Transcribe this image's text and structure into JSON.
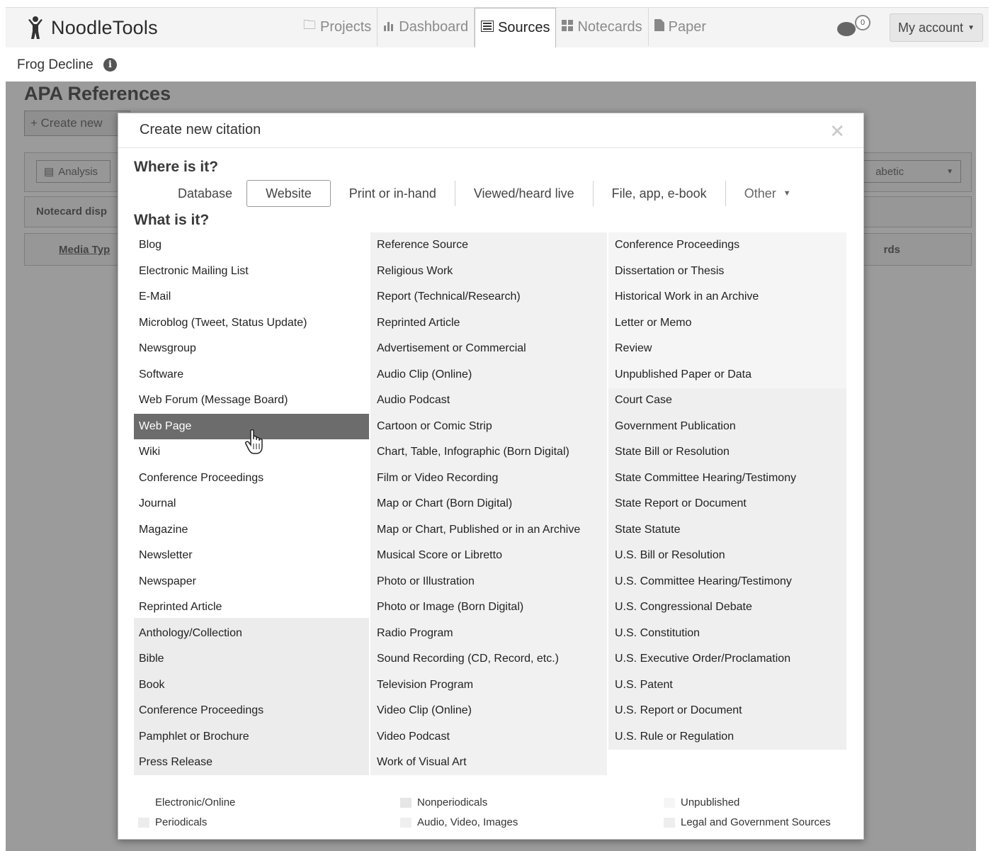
{
  "app": {
    "brand": "NoodleTools",
    "nav": [
      {
        "label": "Projects",
        "icon": "folder-icon"
      },
      {
        "label": "Dashboard",
        "icon": "bar-chart-icon"
      },
      {
        "label": "Sources",
        "icon": "list-icon",
        "active": true
      },
      {
        "label": "Notecards",
        "icon": "grid-icon"
      },
      {
        "label": "Paper",
        "icon": "document-icon"
      }
    ],
    "notifications_count": "0",
    "account_label": "My account"
  },
  "project": {
    "title": "Frog Decline"
  },
  "background": {
    "heading": "APA References",
    "create_button": "+ Create new",
    "analysis_button": "Analysis",
    "sort_select": "abetic",
    "notecard_label": "Notecard disp",
    "media_type_label": "Media Typ",
    "cards_label": "rds"
  },
  "modal": {
    "title": "Create new citation",
    "where_heading": "Where is it?",
    "what_heading": "What is it?",
    "where_tabs": [
      "Database",
      "Website",
      "Print or in-hand",
      "Viewed/heard live",
      "File, app, e-book",
      "Other"
    ],
    "selected_tab": "Website",
    "columns": [
      [
        "Blog",
        "Electronic Mailing List",
        "E-Mail",
        "Microblog (Tweet, Status Update)",
        "Newsgroup",
        "Software",
        "Web Forum (Message Board)",
        "Web Page",
        "Wiki",
        "Conference Proceedings",
        "Journal",
        "Magazine",
        "Newsletter",
        "Newspaper",
        "Reprinted Article",
        "Anthology/Collection",
        "Bible",
        "Book",
        "Conference Proceedings",
        "Pamphlet or Brochure",
        "Press Release"
      ],
      [
        "Reference Source",
        "Religious Work",
        "Report (Technical/Research)",
        "Reprinted Article",
        "Advertisement or Commercial",
        "Audio Clip (Online)",
        "Audio Podcast",
        "Cartoon or Comic Strip",
        "Chart, Table, Infographic (Born Digital)",
        "Film or Video Recording",
        "Map or Chart (Born Digital)",
        "Map or Chart, Published or in an Archive",
        "Musical Score or Libretto",
        "Photo or Illustration",
        "Photo or Image (Born Digital)",
        "Radio Program",
        "Sound Recording (CD, Record, etc.)",
        "Television Program",
        "Video Clip (Online)",
        "Video Podcast",
        "Work of Visual Art"
      ],
      [
        "Conference Proceedings",
        "Dissertation or Thesis",
        "Historical Work in an Archive",
        "Letter or Memo",
        "Review",
        "Unpublished Paper or Data",
        "Court Case",
        "Government Publication",
        "State Bill or Resolution",
        "State Committee Hearing/Testimony",
        "State Report or Document",
        "State Statute",
        "U.S. Bill or Resolution",
        "U.S. Committee Hearing/Testimony",
        "U.S. Congressional Debate",
        "U.S. Constitution",
        "U.S. Executive Order/Proclamation",
        "U.S. Patent",
        "U.S. Report or Document",
        "U.S. Rule or Regulation"
      ]
    ],
    "selected_item": "Web Page",
    "legend": [
      {
        "label": "Electronic/Online",
        "color": "#ffffff"
      },
      {
        "label": "Periodicals",
        "color": "#ececec"
      },
      {
        "label": "Nonperiodicals",
        "color": "#e6e6e6"
      },
      {
        "label": "Audio, Video, Images",
        "color": "#efefef"
      },
      {
        "label": "Unpublished",
        "color": "#f5f5f5"
      },
      {
        "label": "Legal and Government Sources",
        "color": "#eeeeee"
      }
    ]
  },
  "colors": {
    "selected_row": "#6c6c6c",
    "backdrop": "#9b9b9b"
  }
}
